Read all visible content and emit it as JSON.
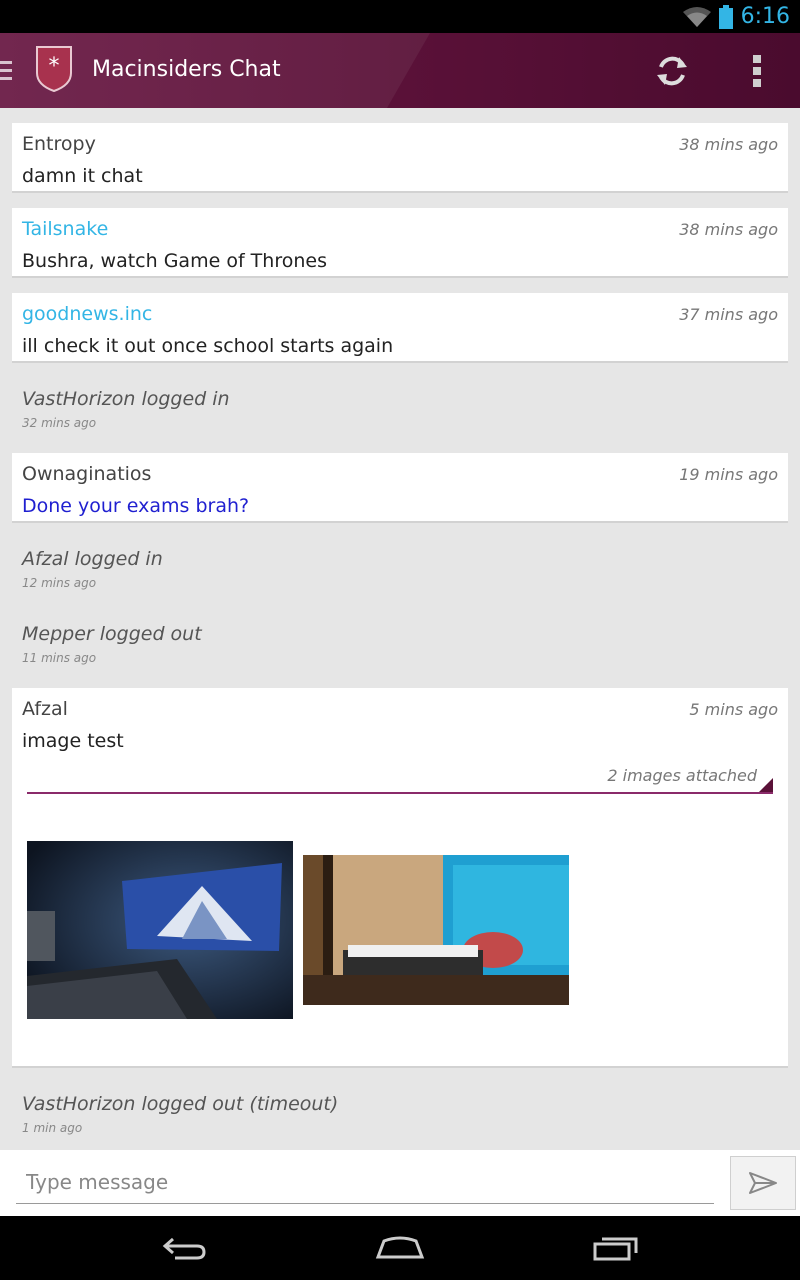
{
  "status_bar": {
    "time": "6:16"
  },
  "app_bar": {
    "title": "Macinsiders Chat"
  },
  "messages": [
    {
      "author": "Entropy",
      "time": "38 mins ago",
      "text": "damn it chat"
    },
    {
      "author": "Tailsnake",
      "time": "38 mins ago",
      "text": "Bushra, watch Game of Thrones"
    },
    {
      "author": "goodnews.inc",
      "time": "37 mins ago",
      "text": "ill check it out once school starts again"
    },
    {
      "author": "Ownaginatios",
      "time": "19 mins ago",
      "text": "Done your exams brah?"
    },
    {
      "author": "Afzal",
      "time": "5 mins ago",
      "text": "image test",
      "attachments_label": "2 images attached"
    }
  ],
  "events": [
    {
      "text": "VastHorizon logged in",
      "time": "32 mins ago"
    },
    {
      "text": "Afzal logged in",
      "time": "12 mins ago"
    },
    {
      "text": "Mepper logged out",
      "time": "11 mins ago"
    },
    {
      "text": "VastHorizon logged out (timeout)",
      "time": "1 min ago"
    }
  ],
  "composer": {
    "placeholder": "Type message"
  },
  "colors": {
    "action_bar": "#5a1138",
    "accent_cyan": "#33b5e5",
    "link_blue": "#1f1fd0",
    "attach_line": "#8a2a6a"
  }
}
